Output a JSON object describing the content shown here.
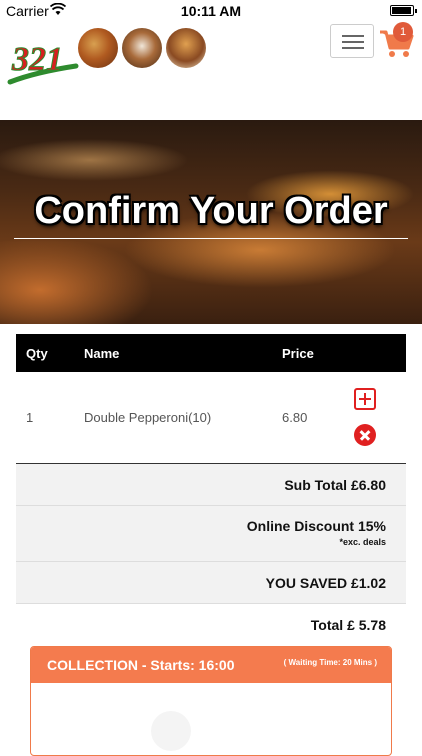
{
  "status_bar": {
    "carrier": "Carrier",
    "time": "10:11 AM"
  },
  "header": {
    "logo_text": "321",
    "cart_count": "1",
    "thumbnails": [
      "pizza-thumb",
      "steak-thumb",
      "burger-thumb"
    ]
  },
  "hero": {
    "title": "Confirm Your Order"
  },
  "order": {
    "columns": {
      "qty": "Qty",
      "name": "Name",
      "price": "Price"
    },
    "items": [
      {
        "qty": "1",
        "name": "Double Pepperoni(10)",
        "price": "6.80"
      }
    ]
  },
  "summary": {
    "subtotal": "Sub Total £6.80",
    "discount": "Online Discount 15%",
    "discount_note": "*exc. deals",
    "saved": "YOU SAVED £1.02",
    "total": "Total £ 5.78"
  },
  "collection": {
    "title": "COLLECTION - Starts: 16:00",
    "waiting": "( Waiting Time: 20 Mins )"
  },
  "colors": {
    "accent": "#f47b4e",
    "danger": "#e02020",
    "header_bg": "#000000"
  }
}
